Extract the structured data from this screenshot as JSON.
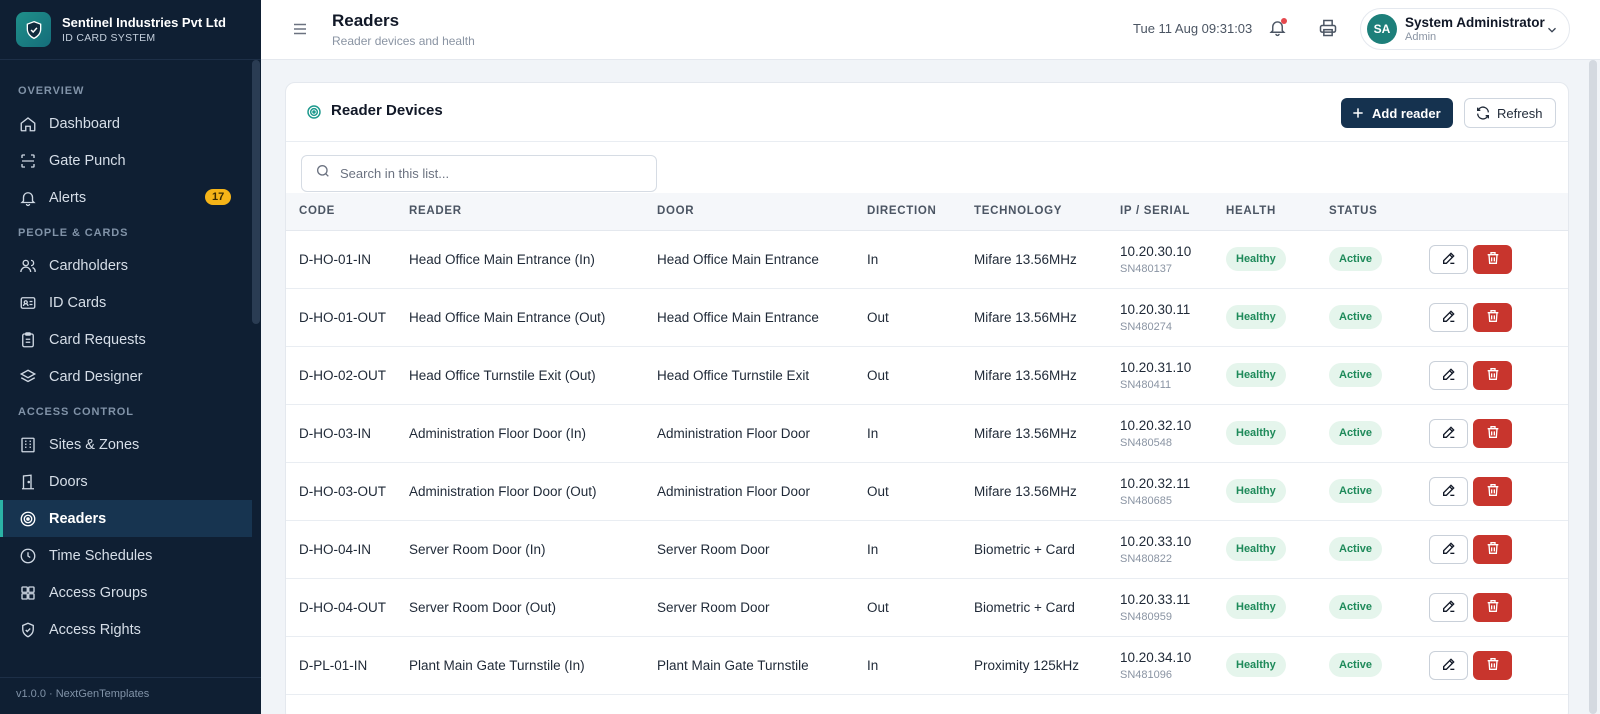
{
  "brand": {
    "name": "Sentinel Industries Pvt Ltd",
    "subtitle": "ID CARD SYSTEM"
  },
  "sidebar": {
    "sections": [
      {
        "label": "OVERVIEW",
        "items": [
          {
            "label": "Dashboard",
            "icon": "home-icon"
          },
          {
            "label": "Gate Punch",
            "icon": "scan-icon"
          },
          {
            "label": "Alerts",
            "icon": "bell-icon",
            "badge": "17"
          }
        ]
      },
      {
        "label": "PEOPLE & CARDS",
        "items": [
          {
            "label": "Cardholders",
            "icon": "users-icon"
          },
          {
            "label": "ID Cards",
            "icon": "id-card-icon"
          },
          {
            "label": "Card Requests",
            "icon": "clipboard-icon"
          },
          {
            "label": "Card Designer",
            "icon": "layers-icon"
          }
        ]
      },
      {
        "label": "ACCESS CONTROL",
        "items": [
          {
            "label": "Sites & Zones",
            "icon": "building-icon"
          },
          {
            "label": "Doors",
            "icon": "door-icon"
          },
          {
            "label": "Readers",
            "icon": "target-icon",
            "active": true
          },
          {
            "label": "Time Schedules",
            "icon": "clock-icon"
          },
          {
            "label": "Access Groups",
            "icon": "grid-icon"
          },
          {
            "label": "Access Rights",
            "icon": "shield-icon"
          }
        ]
      }
    ],
    "footer": "v1.0.0 · NextGenTemplates"
  },
  "header": {
    "title": "Readers",
    "subtitle": "Reader devices and health",
    "datetime": "Tue 11 Aug 09:31:03",
    "user": {
      "initials": "SA",
      "name": "System Administrator",
      "role": "Admin"
    }
  },
  "card": {
    "title": "Reader Devices",
    "add_label": "Add reader",
    "refresh_label": "Refresh",
    "search_placeholder": "Search in this list..."
  },
  "table": {
    "columns": [
      "CODE",
      "READER",
      "DOOR",
      "DIRECTION",
      "TECHNOLOGY",
      "IP / SERIAL",
      "HEALTH",
      "STATUS"
    ],
    "rows": [
      {
        "code": "D-HO-01-IN",
        "reader": "Head Office Main Entrance (In)",
        "door": "Head Office Main Entrance",
        "direction": "In",
        "technology": "Mifare 13.56MHz",
        "ip": "10.20.30.10",
        "serial": "SN480137",
        "health": "Healthy",
        "status": "Active"
      },
      {
        "code": "D-HO-01-OUT",
        "reader": "Head Office Main Entrance (Out)",
        "door": "Head Office Main Entrance",
        "direction": "Out",
        "technology": "Mifare 13.56MHz",
        "ip": "10.20.30.11",
        "serial": "SN480274",
        "health": "Healthy",
        "status": "Active"
      },
      {
        "code": "D-HO-02-OUT",
        "reader": "Head Office Turnstile Exit (Out)",
        "door": "Head Office Turnstile Exit",
        "direction": "Out",
        "technology": "Mifare 13.56MHz",
        "ip": "10.20.31.10",
        "serial": "SN480411",
        "health": "Healthy",
        "status": "Active"
      },
      {
        "code": "D-HO-03-IN",
        "reader": "Administration Floor Door (In)",
        "door": "Administration Floor Door",
        "direction": "In",
        "technology": "Mifare 13.56MHz",
        "ip": "10.20.32.10",
        "serial": "SN480548",
        "health": "Healthy",
        "status": "Active"
      },
      {
        "code": "D-HO-03-OUT",
        "reader": "Administration Floor Door (Out)",
        "door": "Administration Floor Door",
        "direction": "Out",
        "technology": "Mifare 13.56MHz",
        "ip": "10.20.32.11",
        "serial": "SN480685",
        "health": "Healthy",
        "status": "Active"
      },
      {
        "code": "D-HO-04-IN",
        "reader": "Server Room Door (In)",
        "door": "Server Room Door",
        "direction": "In",
        "technology": "Biometric + Card",
        "ip": "10.20.33.10",
        "serial": "SN480822",
        "health": "Healthy",
        "status": "Active"
      },
      {
        "code": "D-HO-04-OUT",
        "reader": "Server Room Door (Out)",
        "door": "Server Room Door",
        "direction": "Out",
        "technology": "Biometric + Card",
        "ip": "10.20.33.11",
        "serial": "SN480959",
        "health": "Healthy",
        "status": "Active"
      },
      {
        "code": "D-PL-01-IN",
        "reader": "Plant Main Gate Turnstile (In)",
        "door": "Plant Main Gate Turnstile",
        "direction": "In",
        "technology": "Proximity 125kHz",
        "ip": "10.20.34.10",
        "serial": "SN481096",
        "health": "Healthy",
        "status": "Active"
      }
    ]
  },
  "colors": {
    "sidebar_bg": "#0f1f33",
    "accent": "#2bb3a6",
    "primary_button": "#15324f",
    "danger": "#c8352d",
    "badge": "#f5b418",
    "success_text": "#1e8a5a"
  }
}
